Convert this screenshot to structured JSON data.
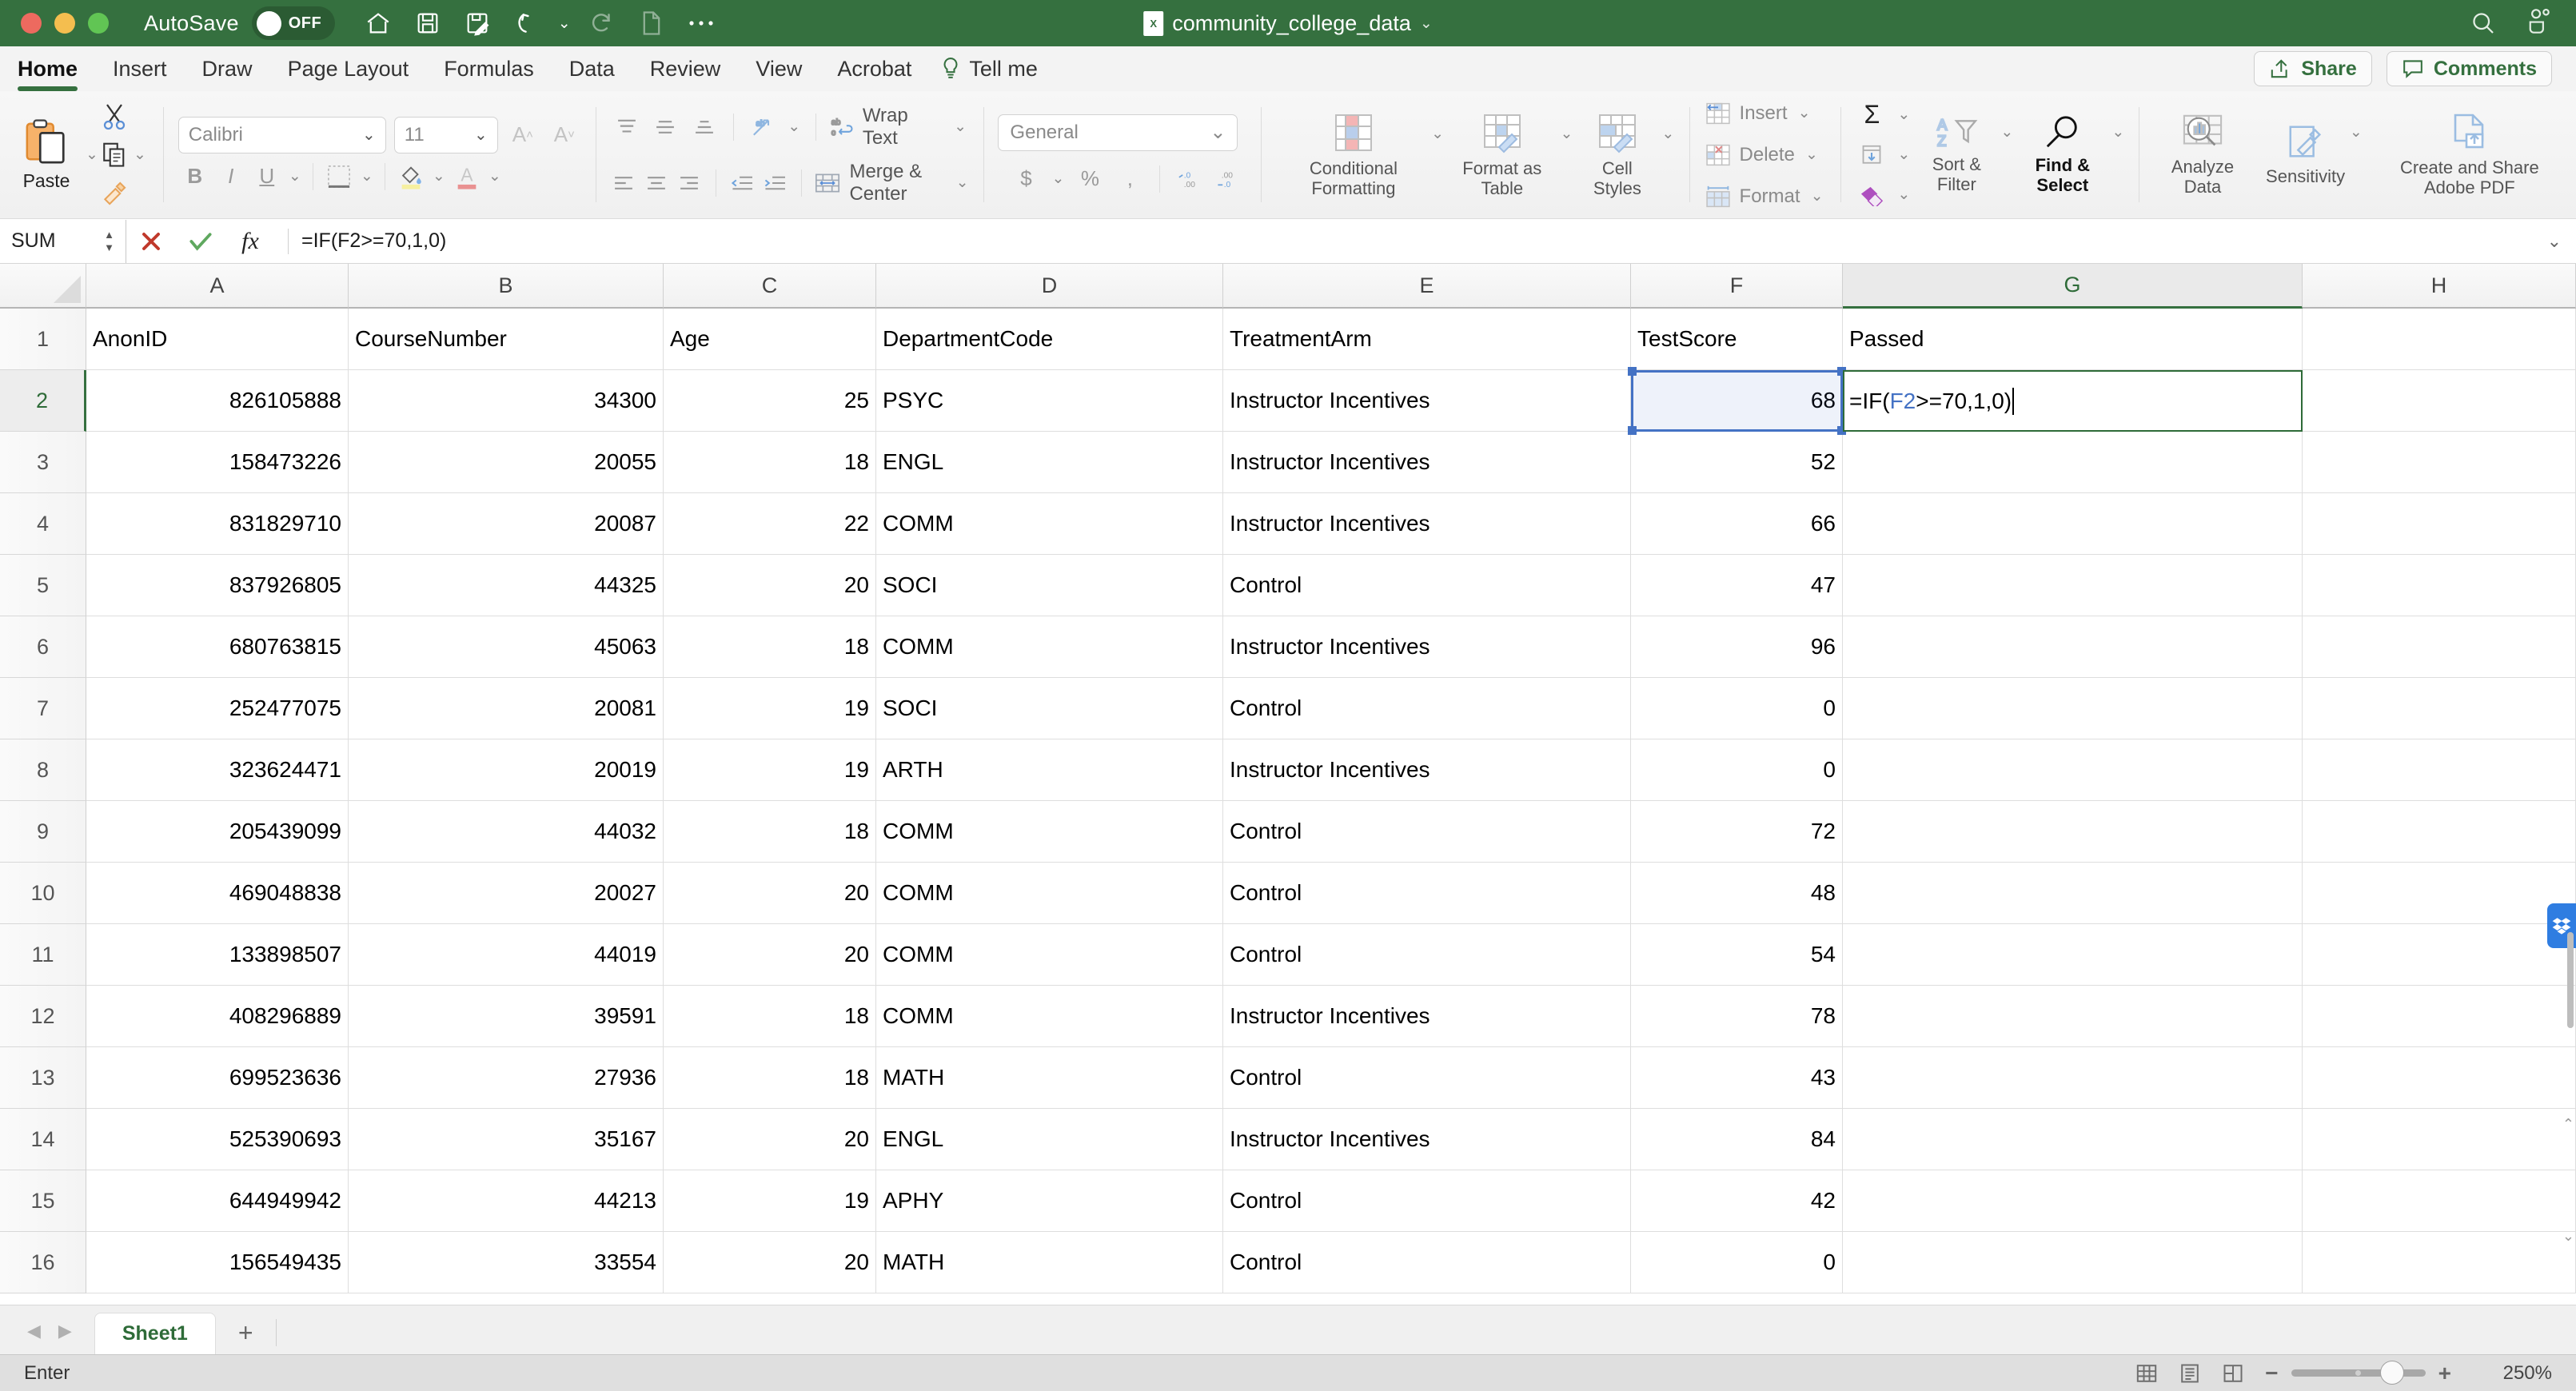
{
  "titlebar": {
    "autosave_label": "AutoSave",
    "autosave_state": "OFF",
    "document_title": "community_college_data",
    "quick_access": [
      {
        "name": "home-icon",
        "label": "Home"
      },
      {
        "name": "save-icon",
        "label": "Save"
      },
      {
        "name": "save-as-icon",
        "label": "Save As"
      },
      {
        "name": "undo-icon",
        "label": "Undo"
      },
      {
        "name": "redo-icon",
        "label": "Redo"
      },
      {
        "name": "new-file-icon",
        "label": "New"
      },
      {
        "name": "more-icon",
        "label": "More"
      }
    ],
    "search_label": "Search",
    "account_label": "Account"
  },
  "tabs": [
    {
      "label": "Home",
      "active": true
    },
    {
      "label": "Insert",
      "active": false
    },
    {
      "label": "Draw",
      "active": false
    },
    {
      "label": "Page Layout",
      "active": false
    },
    {
      "label": "Formulas",
      "active": false
    },
    {
      "label": "Data",
      "active": false
    },
    {
      "label": "Review",
      "active": false
    },
    {
      "label": "View",
      "active": false
    },
    {
      "label": "Acrobat",
      "active": false
    }
  ],
  "tell_me": "Tell me",
  "share_button": "Share",
  "comments_button": "Comments",
  "ribbon": {
    "paste_label": "Paste",
    "font_name": "Calibri",
    "font_size": "11",
    "wrap_text": "Wrap Text",
    "merge_center": "Merge & Center",
    "number_format": "General",
    "conditional_formatting": "Conditional Formatting",
    "format_as_table": "Format as Table",
    "cell_styles": "Cell Styles",
    "insert": "Insert",
    "delete": "Delete",
    "format": "Format",
    "sort_filter": "Sort & Filter",
    "find_select": "Find & Select",
    "analyze_data": "Analyze Data",
    "sensitivity": "Sensitivity",
    "create_share_pdf": "Create and Share Adobe PDF"
  },
  "formula_bar": {
    "name_box": "SUM",
    "cancel_label": "Cancel",
    "enter_label": "Enter",
    "function_label": "Insert Function",
    "formula": "=IF(F2>=70,1,0)"
  },
  "grid": {
    "columns": [
      "A",
      "B",
      "C",
      "D",
      "E",
      "F",
      "G",
      "H"
    ],
    "selected_column": "G",
    "selected_row": "2",
    "row_numbers": [
      "1",
      "2",
      "3",
      "4",
      "5",
      "6",
      "7",
      "8",
      "9",
      "10",
      "11",
      "12",
      "13",
      "14",
      "15",
      "16"
    ],
    "headers": [
      "AnonID",
      "CourseNumber",
      "Age",
      "DepartmentCode",
      "TreatmentArm",
      "TestScore",
      "Passed"
    ],
    "rows": [
      [
        "826105888",
        "34300",
        "25",
        "PSYC",
        "Instructor Incentives",
        "68",
        ""
      ],
      [
        "158473226",
        "20055",
        "18",
        "ENGL",
        "Instructor Incentives",
        "52",
        ""
      ],
      [
        "831829710",
        "20087",
        "22",
        "COMM",
        "Instructor Incentives",
        "66",
        ""
      ],
      [
        "837926805",
        "44325",
        "20",
        "SOCI",
        "Control",
        "47",
        ""
      ],
      [
        "680763815",
        "45063",
        "18",
        "COMM",
        "Instructor Incentives",
        "96",
        ""
      ],
      [
        "252477075",
        "20081",
        "19",
        "SOCI",
        "Control",
        "0",
        ""
      ],
      [
        "323624471",
        "20019",
        "19",
        "ARTH",
        "Instructor Incentives",
        "0",
        ""
      ],
      [
        "205439099",
        "44032",
        "18",
        "COMM",
        "Control",
        "72",
        ""
      ],
      [
        "469048838",
        "20027",
        "20",
        "COMM",
        "Control",
        "48",
        ""
      ],
      [
        "133898507",
        "44019",
        "20",
        "COMM",
        "Control",
        "54",
        ""
      ],
      [
        "408296889",
        "39591",
        "18",
        "COMM",
        "Instructor Incentives",
        "78",
        ""
      ],
      [
        "699523636",
        "27936",
        "18",
        "MATH",
        "Control",
        "43",
        ""
      ],
      [
        "525390693",
        "35167",
        "20",
        "ENGL",
        "Instructor Incentives",
        "84",
        ""
      ],
      [
        "644949942",
        "44213",
        "19",
        "APHY",
        "Control",
        "42",
        ""
      ],
      [
        "156549435",
        "33554",
        "20",
        "MATH",
        "Control",
        "0",
        ""
      ]
    ],
    "editing_cell": {
      "address": "G2",
      "text_before_ref": "=IF(",
      "reference": "F2",
      "text_after_ref": ">=70,1,0)"
    },
    "referenced_cell": "F2"
  },
  "sheet_tabs": {
    "sheets": [
      "Sheet1"
    ],
    "active_sheet": "Sheet1",
    "add_sheet_label": "+"
  },
  "status_bar": {
    "mode": "Enter",
    "views": [
      "normal-view",
      "page-layout-view",
      "page-break-view"
    ],
    "zoom_out_label": "−",
    "zoom_in_label": "+",
    "zoom_level": "250%"
  },
  "colors": {
    "brand_green": "#35703F",
    "selection_blue": "#4472C4",
    "edit_border_green": "#2E6B38",
    "dropbox_blue": "#2F7DE1"
  }
}
